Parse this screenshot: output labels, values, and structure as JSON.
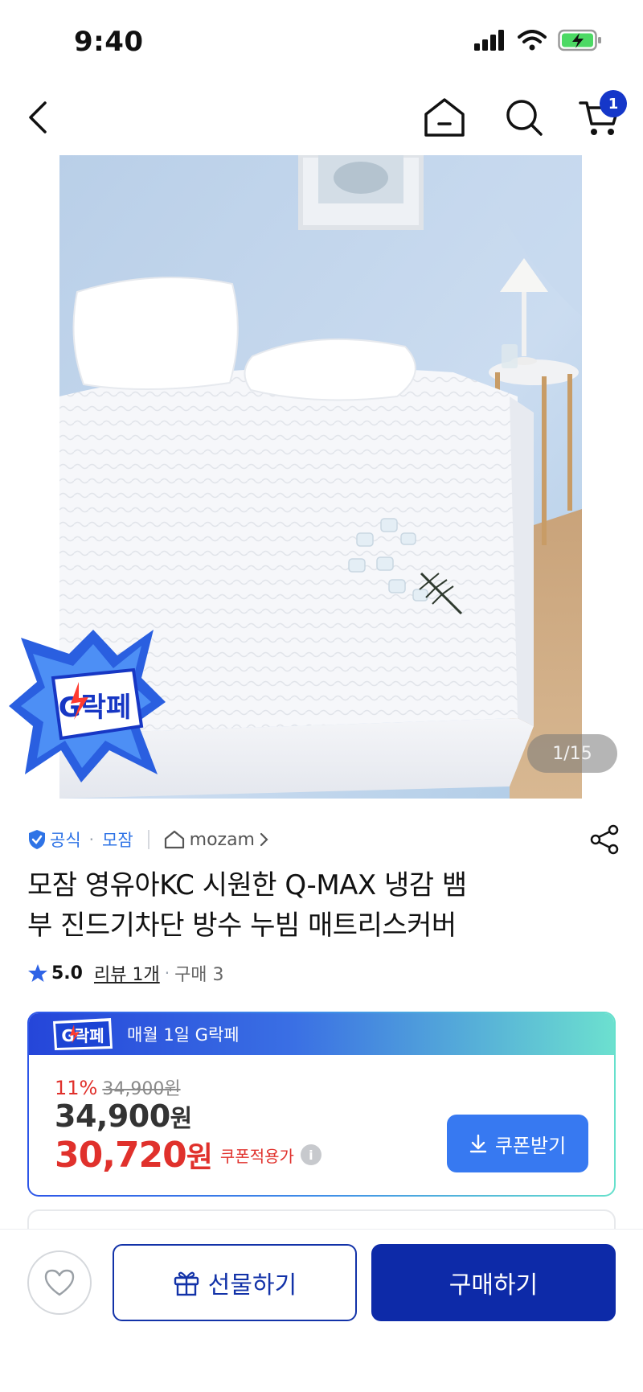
{
  "status_bar": {
    "time": "9:40"
  },
  "nav": {
    "cart_count": "1"
  },
  "hero": {
    "counter": "1/15",
    "sticker_text": "G락페"
  },
  "seller": {
    "official_label": "공식",
    "brand_name": "모잠",
    "store_name": "mozam"
  },
  "product": {
    "title_line1": "모잠 영유아KC 시원한 Q-MAX 냉감 뱀",
    "title_line2": "부 진드기차단 방수 누빔 매트리스커버",
    "rating": "5.0",
    "review_link": "리뷰 1개",
    "purchase_count": "구매 3"
  },
  "price_card": {
    "logo_text": "G락페",
    "header_text": "매월 1일 G락페",
    "discount_rate": "11%",
    "original_price": "34,900원",
    "sale_price": "34,900",
    "sale_unit": "원",
    "coupon_price": "30,720",
    "coupon_unit": "원",
    "coupon_price_label": "쿠폰적용가",
    "coupon_button": "쿠폰받기"
  },
  "bottom_bar": {
    "gift_button": "선물하기",
    "buy_button": "구매하기"
  },
  "colors": {
    "brand_blue": "#0d2aa8",
    "accent_blue": "#3779f1",
    "price_red": "#e0312c",
    "official_blue": "#2e73e6"
  },
  "icons": [
    "back-icon",
    "home-icon",
    "search-icon",
    "cart-icon",
    "share-icon",
    "star-icon",
    "heart-icon",
    "gift-icon",
    "download-icon",
    "info-icon",
    "shield-check-icon"
  ]
}
